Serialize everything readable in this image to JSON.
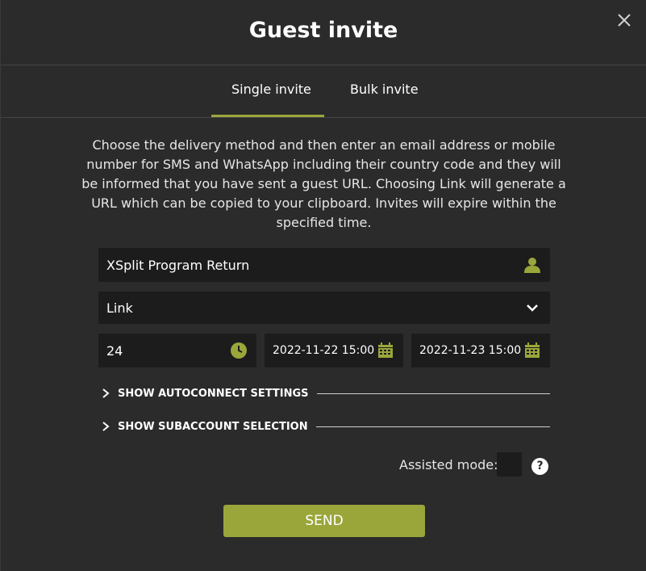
{
  "dialog": {
    "title": "Guest invite",
    "close_icon": "close-icon"
  },
  "tabs": [
    {
      "label": "Single invite",
      "active": true
    },
    {
      "label": "Bulk invite",
      "active": false
    }
  ],
  "description": "Choose the delivery method and then enter an email address or mobile number for SMS and WhatsApp including their country code and they will be informed that you have sent a guest URL. Choosing Link will generate a URL which can be copied to your clipboard. Invites will expire within the specified time.",
  "form": {
    "guest_name": {
      "value": "XSplit Program Return",
      "icon": "user-icon"
    },
    "delivery_method": {
      "value": "Link",
      "icon": "chevron-down-icon"
    },
    "expiry_hours": {
      "value": "24",
      "icon": "clock-icon"
    },
    "start_datetime": {
      "value": "2022-11-22 15:00",
      "icon": "calendar-icon"
    },
    "end_datetime": {
      "value": "2022-11-23 15:00",
      "icon": "calendar-icon"
    }
  },
  "sections": {
    "autoconnect": "SHOW AUTOCONNECT SETTINGS",
    "subaccount": "SHOW SUBACCOUNT SELECTION"
  },
  "assisted_mode": {
    "label": "Assisted mode:",
    "checked": false,
    "help": "?"
  },
  "send_label": "SEND",
  "colors": {
    "accent": "#9aa63a",
    "background": "#2b2b2b",
    "field": "#1c1c1c"
  }
}
